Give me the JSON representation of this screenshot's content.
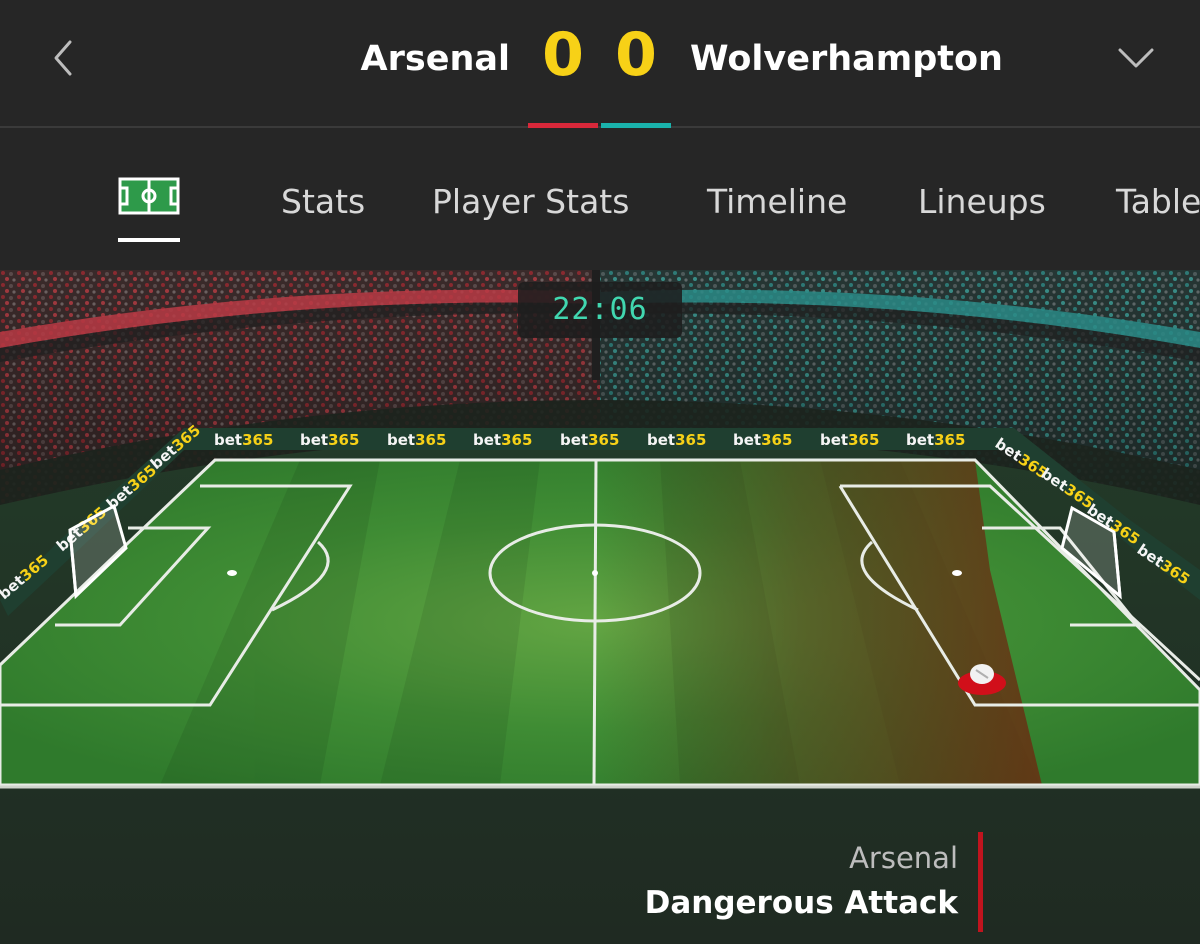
{
  "match": {
    "home_team": "Arsenal",
    "away_team": "Wolverhampton",
    "home_score": "0",
    "away_score": "0",
    "home_color": "#d8283a",
    "away_color": "#1ab3ac"
  },
  "header": {
    "back_icon": "chevron-left-icon",
    "expand_icon": "chevron-down-icon"
  },
  "tabs": [
    {
      "label": "",
      "icon": "pitch-icon",
      "active": true
    },
    {
      "label": "Stats",
      "active": false
    },
    {
      "label": "Player Stats",
      "active": false
    },
    {
      "label": "Timeline",
      "active": false
    },
    {
      "label": "Lineups",
      "active": false
    },
    {
      "label": "Table",
      "active": false
    }
  ],
  "pitch": {
    "clock": "22:06",
    "sponsor": "bet365",
    "event_team": "Arsenal",
    "event_type": "Dangerous Attack"
  }
}
